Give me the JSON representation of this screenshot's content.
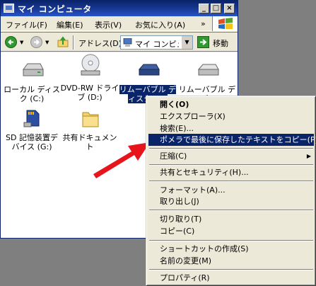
{
  "window": {
    "title": "マイ コンピュータ",
    "minimize_glyph": "_",
    "maximize_glyph": "□",
    "close_glyph": "×"
  },
  "menubar": {
    "items": [
      "ファイル(F)",
      "編集(E)",
      "表示(V)",
      "お気に入り(A)",
      "»"
    ]
  },
  "toolbar": {
    "address_label": "アドレス(D)",
    "address_value": "マイ コンピュータ",
    "go_label": "移動"
  },
  "drives": [
    {
      "label": "ローカル ディスク (C:)",
      "icon": "hard-disk-icon"
    },
    {
      "label": "DVD-RW ドライブ (D:)",
      "icon": "dvd-drive-icon"
    },
    {
      "label": "リムーバブル ディスク (E:)",
      "icon": "removable-disk-icon"
    },
    {
      "label": "リムーバブル ディスク (F:)",
      "icon": "removable-disk-icon"
    },
    {
      "label": "SD 記憶装置デバイス (G:)",
      "icon": "sd-card-icon"
    },
    {
      "label": "共有ドキュメント",
      "icon": "folder-icon"
    }
  ],
  "context_menu": {
    "items": [
      {
        "label": "開く(O)"
      },
      {
        "label": "エクスプローラ(X)"
      },
      {
        "label": "検索(E)..."
      },
      {
        "label": "ポメラで最後に保存したテキストをコピー(P)"
      },
      {
        "label": "圧縮(C)"
      },
      {
        "label": "共有とセキュリティ(H)..."
      },
      {
        "label": "フォーマット(A)..."
      },
      {
        "label": "取り出し(J)"
      },
      {
        "label": "切り取り(T)"
      },
      {
        "label": "コピー(C)"
      },
      {
        "label": "ショートカットの作成(S)"
      },
      {
        "label": "名前の変更(M)"
      },
      {
        "label": "プロパティ(R)"
      }
    ]
  },
  "colors": {
    "highlight": "#0a246a",
    "annotation_arrow": "#e8141b"
  }
}
